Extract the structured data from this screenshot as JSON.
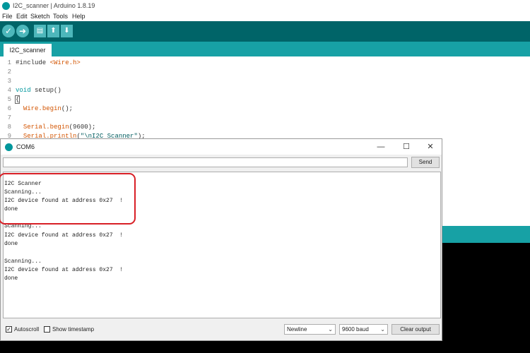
{
  "app": {
    "title": "I2C_scanner | Arduino 1.8.19",
    "menu": [
      "File",
      "Edit",
      "Sketch",
      "Tools",
      "Help"
    ],
    "toolbar": {
      "verify_icon": "check-icon",
      "upload_icon": "arrow-right-icon",
      "new_icon": "new-file-icon",
      "open_icon": "arrow-up-icon",
      "save_icon": "arrow-down-icon"
    },
    "tab_label": "I2C_scanner",
    "accent_color": "#00979c"
  },
  "editor": {
    "lines": [
      {
        "num": "1",
        "text": "#include <Wire.h>"
      },
      {
        "num": "2",
        "text": ""
      },
      {
        "num": "3",
        "text": ""
      },
      {
        "num": "4",
        "text": "void setup()"
      },
      {
        "num": "5",
        "text": "{"
      },
      {
        "num": "6",
        "text": "  Wire.begin();"
      },
      {
        "num": "7",
        "text": ""
      },
      {
        "num": "8",
        "text": "  Serial.begin(9600);"
      },
      {
        "num": "9",
        "text": "  Serial.println(\"\\nI2C Scanner\");"
      }
    ]
  },
  "serial_monitor": {
    "title": "COM6",
    "send_label": "Send",
    "input_value": "",
    "output_lines": [
      "",
      "I2C Scanner",
      "Scanning...",
      "I2C device found at address 0x27  !",
      "done",
      "",
      "Scanning...",
      "I2C device found at address 0x27  !",
      "done",
      "",
      "Scanning...",
      "I2C device found at address 0x27  !",
      "done"
    ],
    "autoscroll_label": "Autoscroll",
    "autoscroll_checked": true,
    "timestamp_label": "Show timestamp",
    "timestamp_checked": false,
    "line_ending": "Newline",
    "baud_rate": "9600 baud",
    "clear_label": "Clear output",
    "highlight_color": "#d81f26"
  }
}
